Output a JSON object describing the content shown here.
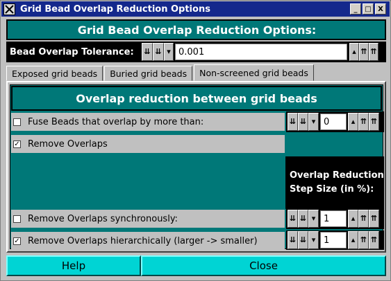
{
  "window": {
    "title": "Grid Bead Overlap Reduction Options",
    "buttons": {
      "minimize": "_",
      "maximize": "□",
      "close": "X"
    }
  },
  "header": {
    "title": "Grid Bead Overlap Reduction Options:"
  },
  "tolerance": {
    "label": "Bead Overlap Tolerance:",
    "value": "0.001"
  },
  "tabs": [
    {
      "label": "Exposed grid beads",
      "active": false
    },
    {
      "label": "Buried grid beads",
      "active": false
    },
    {
      "label": "Non-screened grid beads",
      "active": true
    }
  ],
  "panel": {
    "title": "Overlap reduction between grid beads",
    "options": [
      {
        "label": "Fuse Beads that overlap by more than:",
        "checked": false,
        "value": "0"
      },
      {
        "label": "Remove Overlaps",
        "checked": true
      },
      {
        "label": "Remove Overlaps synchronously:",
        "checked": false,
        "value": "1"
      },
      {
        "label": "Remove Overlaps hierarchically (larger -> smaller)",
        "checked": true,
        "value": "1"
      }
    ],
    "step_label_line1": "Overlap Reduction",
    "step_label_line2": "Step Size (in %):"
  },
  "footer": {
    "help": "Help",
    "close": "Close"
  },
  "colors": {
    "teal": "#007878",
    "cyan_button": "#00d4d4",
    "titlebar": "#14288c"
  }
}
